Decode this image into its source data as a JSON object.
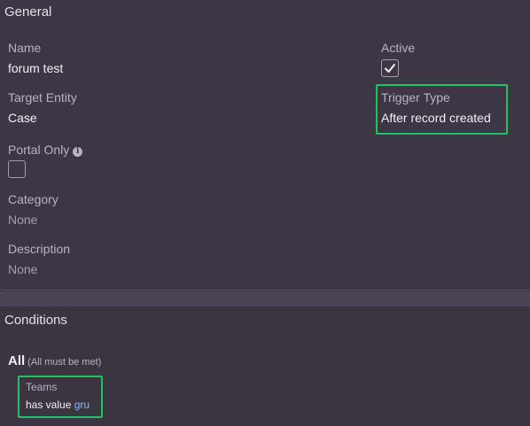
{
  "general": {
    "heading": "General",
    "name": {
      "label": "Name",
      "value": "forum test"
    },
    "active": {
      "label": "Active",
      "checked": true
    },
    "target_entity": {
      "label": "Target Entity",
      "value": "Case"
    },
    "trigger_type": {
      "label": "Trigger Type",
      "value": "After record created"
    },
    "portal_only": {
      "label": "Portal Only",
      "checked": false,
      "info_icon": "info-icon"
    },
    "category": {
      "label": "Category",
      "value": "None"
    },
    "description": {
      "label": "Description",
      "value": "None"
    }
  },
  "conditions": {
    "heading": "Conditions",
    "group_label": "All",
    "group_note": "(All must be met)",
    "items": [
      {
        "field": "Teams",
        "operator": "has value",
        "value": "gru"
      }
    ]
  },
  "colors": {
    "background": "#3b3542",
    "highlight": "#1fc462",
    "link": "#8fb4ff"
  }
}
